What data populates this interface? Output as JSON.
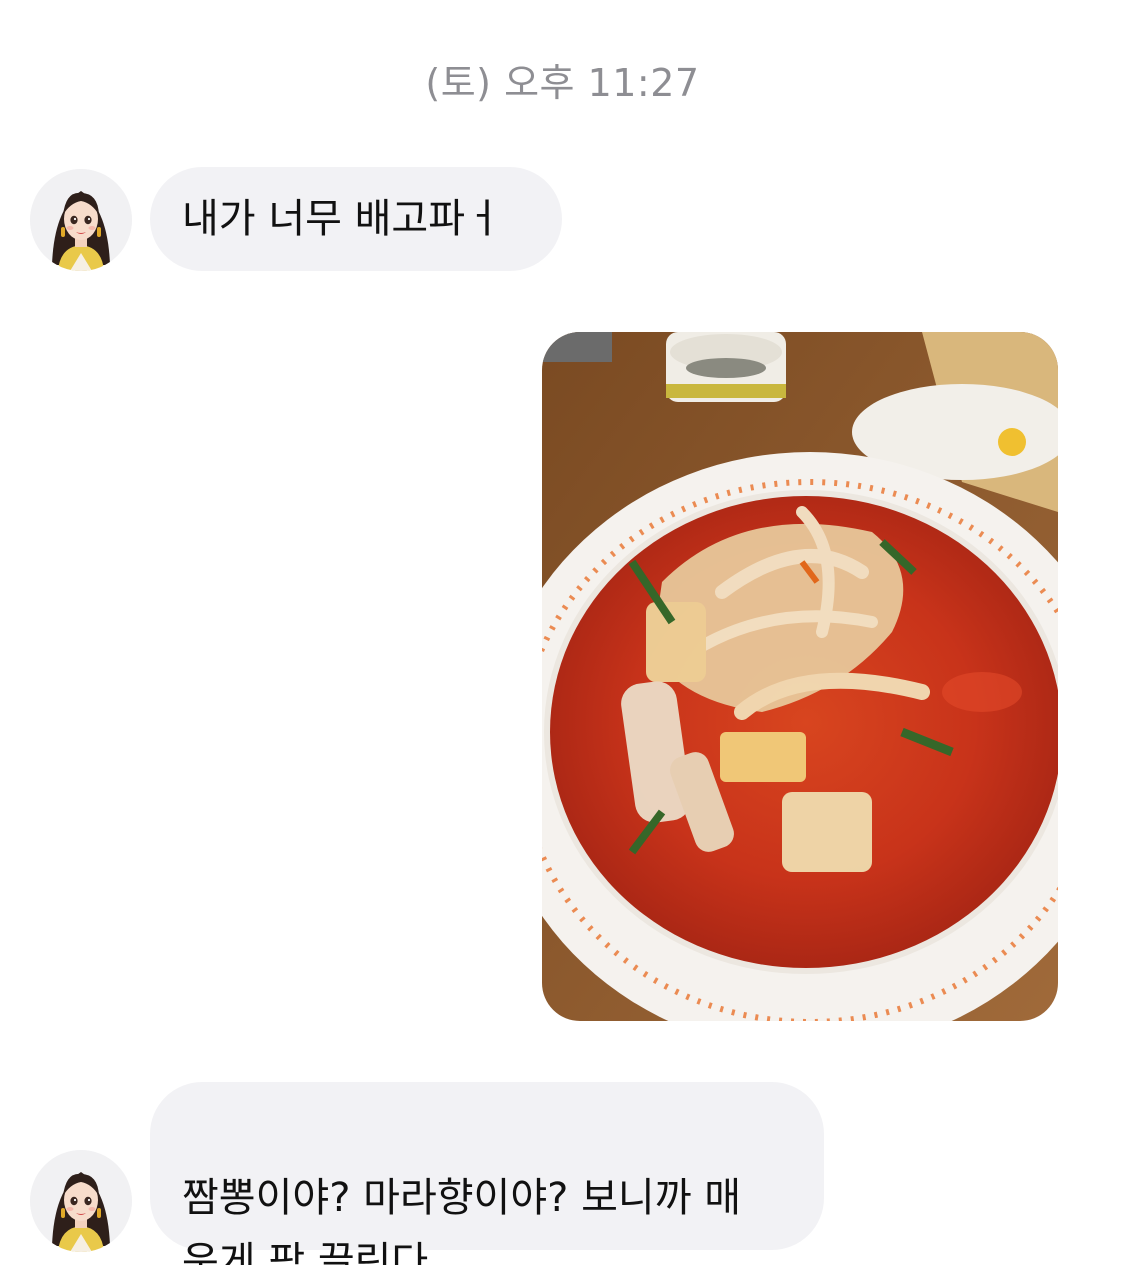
{
  "conversation": {
    "timestamp": "(토) 오후 11:27",
    "messages": [
      {
        "sender": "other",
        "type": "text",
        "text": "내가 너무 배고파ㅓ"
      },
      {
        "sender": "me",
        "type": "image",
        "image_subject": "spicy red noodle soup with squid, zucchini and onions in a white bowl"
      },
      {
        "sender": "other",
        "type": "text",
        "text": "짬뽕이야? 마라향이야? 보니까 매\n운게 팍 끌린다"
      }
    ]
  },
  "colors": {
    "bubble_background": "#f2f2f5",
    "timestamp_text": "#8e8e93",
    "message_text": "#111111"
  }
}
